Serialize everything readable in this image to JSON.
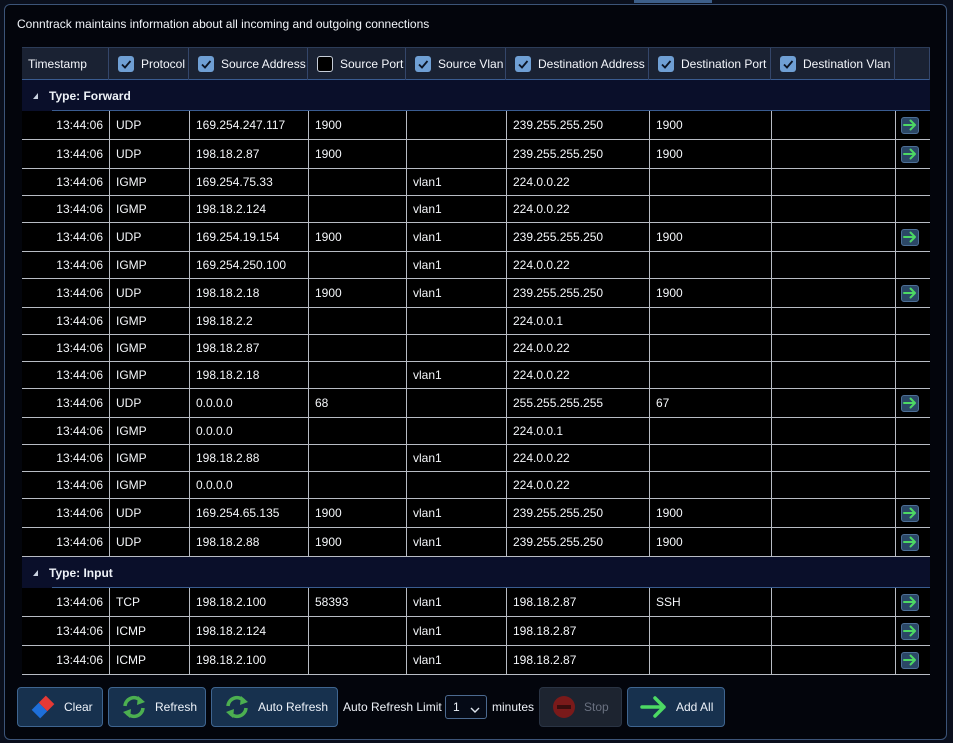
{
  "info_text": "Conntrack maintains information about all incoming and outgoing connections",
  "columns": [
    {
      "label": "Timestamp",
      "checkbox": "none"
    },
    {
      "label": "Protocol",
      "checkbox": "checked"
    },
    {
      "label": "Source Address",
      "checkbox": "checked"
    },
    {
      "label": "Source Port",
      "checkbox": "unchecked"
    },
    {
      "label": "Source Vlan",
      "checkbox": "checked"
    },
    {
      "label": "Destination Address",
      "checkbox": "checked"
    },
    {
      "label": "Destination Port",
      "checkbox": "checked"
    },
    {
      "label": "Destination Vlan",
      "checkbox": "checked"
    }
  ],
  "groups": [
    {
      "title": "Type: Forward",
      "rows": [
        {
          "ts": "13:44:06",
          "proto": "UDP",
          "saddr": "169.254.247.117",
          "sport": "1900",
          "svlan": "",
          "daddr": "239.255.255.250",
          "dport": "1900",
          "dvlan": "",
          "action": true
        },
        {
          "ts": "13:44:06",
          "proto": "UDP",
          "saddr": "198.18.2.87",
          "sport": "1900",
          "svlan": "",
          "daddr": "239.255.255.250",
          "dport": "1900",
          "dvlan": "",
          "action": true
        },
        {
          "ts": "13:44:06",
          "proto": "IGMP",
          "saddr": "169.254.75.33",
          "sport": "",
          "svlan": "vlan1",
          "daddr": "224.0.0.22",
          "dport": "",
          "dvlan": "",
          "action": false
        },
        {
          "ts": "13:44:06",
          "proto": "IGMP",
          "saddr": "198.18.2.124",
          "sport": "",
          "svlan": "vlan1",
          "daddr": "224.0.0.22",
          "dport": "",
          "dvlan": "",
          "action": false
        },
        {
          "ts": "13:44:06",
          "proto": "UDP",
          "saddr": "169.254.19.154",
          "sport": "1900",
          "svlan": "vlan1",
          "daddr": "239.255.255.250",
          "dport": "1900",
          "dvlan": "",
          "action": true
        },
        {
          "ts": "13:44:06",
          "proto": "IGMP",
          "saddr": "169.254.250.100",
          "sport": "",
          "svlan": "vlan1",
          "daddr": "224.0.0.22",
          "dport": "",
          "dvlan": "",
          "action": false
        },
        {
          "ts": "13:44:06",
          "proto": "UDP",
          "saddr": "198.18.2.18",
          "sport": "1900",
          "svlan": "vlan1",
          "daddr": "239.255.255.250",
          "dport": "1900",
          "dvlan": "",
          "action": true
        },
        {
          "ts": "13:44:06",
          "proto": "IGMP",
          "saddr": "198.18.2.2",
          "sport": "",
          "svlan": "",
          "daddr": "224.0.0.1",
          "dport": "",
          "dvlan": "",
          "action": false
        },
        {
          "ts": "13:44:06",
          "proto": "IGMP",
          "saddr": "198.18.2.87",
          "sport": "",
          "svlan": "",
          "daddr": "224.0.0.22",
          "dport": "",
          "dvlan": "",
          "action": false
        },
        {
          "ts": "13:44:06",
          "proto": "IGMP",
          "saddr": "198.18.2.18",
          "sport": "",
          "svlan": "vlan1",
          "daddr": "224.0.0.22",
          "dport": "",
          "dvlan": "",
          "action": false
        },
        {
          "ts": "13:44:06",
          "proto": "UDP",
          "saddr": "0.0.0.0",
          "sport": "68",
          "svlan": "",
          "daddr": "255.255.255.255",
          "dport": "67",
          "dvlan": "",
          "action": true
        },
        {
          "ts": "13:44:06",
          "proto": "IGMP",
          "saddr": "0.0.0.0",
          "sport": "",
          "svlan": "",
          "daddr": "224.0.0.1",
          "dport": "",
          "dvlan": "",
          "action": false
        },
        {
          "ts": "13:44:06",
          "proto": "IGMP",
          "saddr": "198.18.2.88",
          "sport": "",
          "svlan": "vlan1",
          "daddr": "224.0.0.22",
          "dport": "",
          "dvlan": "",
          "action": false
        },
        {
          "ts": "13:44:06",
          "proto": "IGMP",
          "saddr": "0.0.0.0",
          "sport": "",
          "svlan": "",
          "daddr": "224.0.0.22",
          "dport": "",
          "dvlan": "",
          "action": false
        },
        {
          "ts": "13:44:06",
          "proto": "UDP",
          "saddr": "169.254.65.135",
          "sport": "1900",
          "svlan": "vlan1",
          "daddr": "239.255.255.250",
          "dport": "1900",
          "dvlan": "",
          "action": true
        },
        {
          "ts": "13:44:06",
          "proto": "UDP",
          "saddr": "198.18.2.88",
          "sport": "1900",
          "svlan": "vlan1",
          "daddr": "239.255.255.250",
          "dport": "1900",
          "dvlan": "",
          "action": true
        }
      ]
    },
    {
      "title": "Type: Input",
      "rows": [
        {
          "ts": "13:44:06",
          "proto": "TCP",
          "saddr": "198.18.2.100",
          "sport": "58393",
          "svlan": "vlan1",
          "daddr": "198.18.2.87",
          "dport": "SSH",
          "dvlan": "",
          "action": true
        },
        {
          "ts": "13:44:06",
          "proto": "ICMP",
          "saddr": "198.18.2.124",
          "sport": "",
          "svlan": "vlan1",
          "daddr": "198.18.2.87",
          "dport": "",
          "dvlan": "",
          "action": true
        },
        {
          "ts": "13:44:06",
          "proto": "ICMP",
          "saddr": "198.18.2.100",
          "sport": "",
          "svlan": "vlan1",
          "daddr": "198.18.2.87",
          "dport": "",
          "dvlan": "",
          "action": true
        }
      ]
    }
  ],
  "footer": {
    "clear_label": "Clear",
    "refresh_label": "Refresh",
    "auto_refresh_label": "Auto Refresh",
    "limit_label": "Auto Refresh Limit",
    "limit_value": "1",
    "minutes_label": "minutes",
    "stop_label": "Stop",
    "add_all_label": "Add All"
  },
  "colors": {
    "accent_blue": "#6f9fd4",
    "refresh_green": "#4caf50",
    "arrow_green": "#4cd964",
    "clear_red": "#e53935",
    "clear_blue": "#1e6fd9"
  }
}
